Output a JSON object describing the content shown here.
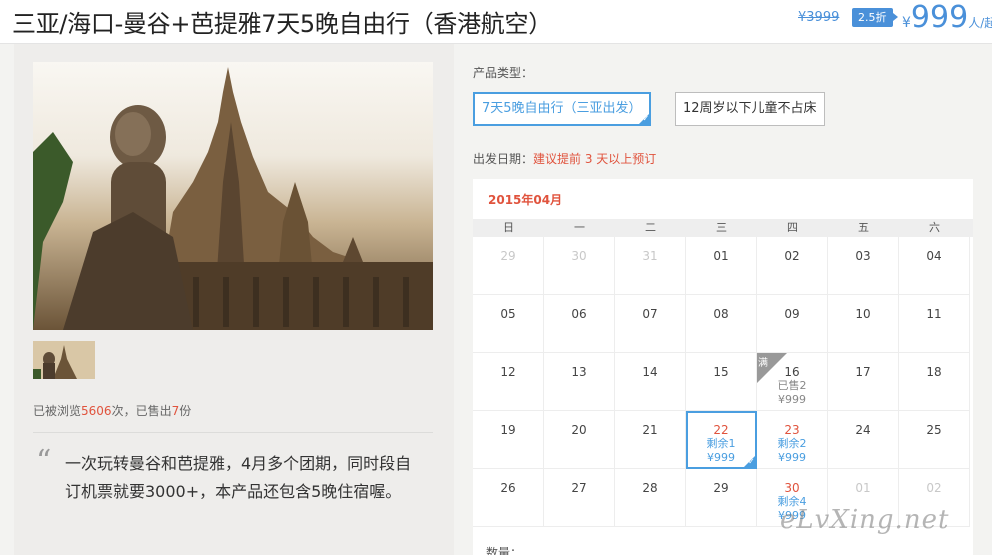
{
  "header": {
    "title": "三亚/海口-曼谷+芭提雅7天5晚自由行（香港航空）",
    "original_price": "¥3999",
    "discount_label": "2.5折",
    "price_currency": "¥",
    "price_value": "999",
    "price_unit": "人/起"
  },
  "gallery": {
    "main_image_alt": "tower-temple-photo",
    "thumbnails": [
      "thumbnail-1"
    ]
  },
  "stats": {
    "prefix": "已被浏览",
    "views": "5606",
    "mid": "次，已售出",
    "sold": "7",
    "suffix": "份"
  },
  "quote": {
    "mark": "“",
    "text": "一次玩转曼谷和芭提雅，4月多个团期，同时段自订机票就要3000+，本产品还包含5晚住宿喔。"
  },
  "product_type": {
    "label": "产品类型：",
    "options": [
      {
        "label": "7天5晚自由行（三亚出发）",
        "selected": true
      },
      {
        "label": "12周岁以下儿童不占床",
        "selected": false
      }
    ]
  },
  "departure": {
    "label": "出发日期：",
    "hint": "建议提前 3 天以上预订"
  },
  "calendar": {
    "month": "2015年04月",
    "weekdays": [
      "日",
      "一",
      "二",
      "三",
      "四",
      "五",
      "六"
    ],
    "cells": [
      {
        "day": "29",
        "other": true
      },
      {
        "day": "30",
        "other": true
      },
      {
        "day": "31",
        "other": true
      },
      {
        "day": "01"
      },
      {
        "day": "02"
      },
      {
        "day": "03"
      },
      {
        "day": "04"
      },
      {
        "day": "05"
      },
      {
        "day": "06"
      },
      {
        "day": "07"
      },
      {
        "day": "08"
      },
      {
        "day": "09"
      },
      {
        "day": "10"
      },
      {
        "day": "11"
      },
      {
        "day": "12"
      },
      {
        "day": "13"
      },
      {
        "day": "14"
      },
      {
        "day": "15"
      },
      {
        "day": "16",
        "status": "已售2",
        "price": "¥999",
        "sold": true,
        "tag": "满"
      },
      {
        "day": "17"
      },
      {
        "day": "18"
      },
      {
        "day": "19"
      },
      {
        "day": "20"
      },
      {
        "day": "21"
      },
      {
        "day": "22",
        "status": "剩余1",
        "price": "¥999",
        "selected": true,
        "color": "red"
      },
      {
        "day": "23",
        "status": "剩余2",
        "price": "¥999",
        "color": "red"
      },
      {
        "day": "24"
      },
      {
        "day": "25"
      },
      {
        "day": "26"
      },
      {
        "day": "27"
      },
      {
        "day": "28"
      },
      {
        "day": "29"
      },
      {
        "day": "30",
        "status": "剩余4",
        "price": "¥999",
        "color": "red"
      },
      {
        "day": "01",
        "other": true
      },
      {
        "day": "02",
        "other": true
      }
    ]
  },
  "quantity": {
    "label": "数量："
  },
  "watermark": "eLvXing.net",
  "colors": {
    "accent": "#4a9ee0",
    "highlight": "#e0533d"
  }
}
